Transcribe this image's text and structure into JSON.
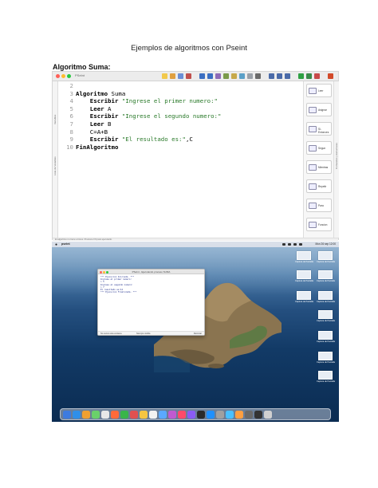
{
  "document": {
    "title": "Ejemplos de algoritmos con Pseint",
    "section": "Algoritmo Suma:"
  },
  "pseint": {
    "window_title": "PSeInt",
    "left_labels": [
      "Variables",
      "Lista de Variables",
      "Operadores y Funciones"
    ],
    "code": [
      {
        "n": "2",
        "parts": []
      },
      {
        "n": "3",
        "parts": [
          {
            "t": "Algoritmo",
            "c": "kw"
          },
          {
            "t": " Suma",
            "c": "id"
          }
        ]
      },
      {
        "n": "4",
        "parts": [
          {
            "t": "    Escribir ",
            "c": "kw"
          },
          {
            "t": "\"Ingrese el primer numero:\"",
            "c": "str"
          }
        ]
      },
      {
        "n": "5",
        "parts": [
          {
            "t": "    Leer ",
            "c": "kw"
          },
          {
            "t": "A",
            "c": "id"
          }
        ]
      },
      {
        "n": "6",
        "parts": [
          {
            "t": "    Escribir ",
            "c": "kw"
          },
          {
            "t": "\"Ingrese el segundo numero:\"",
            "c": "str"
          }
        ]
      },
      {
        "n": "7",
        "parts": [
          {
            "t": "    Leer ",
            "c": "kw"
          },
          {
            "t": "B",
            "c": "id"
          }
        ]
      },
      {
        "n": "8",
        "parts": [
          {
            "t": "    C=A+B",
            "c": "id"
          }
        ]
      },
      {
        "n": "9",
        "parts": [
          {
            "t": "    Escribir ",
            "c": "kw"
          },
          {
            "t": "\"El resultado es:\"",
            "c": "str"
          },
          {
            "t": ",C",
            "c": "id"
          }
        ]
      },
      {
        "n": "10",
        "parts": [
          {
            "t": "FinAlgoritmo",
            "c": "kw"
          }
        ]
      }
    ],
    "commands": [
      "Leer",
      "Asignar",
      "Si-Entonces",
      "Segun",
      "Mientras",
      "Repetir",
      "Para",
      "Funcion"
    ],
    "right_label": "Comandos y Estructuras",
    "status": "El algoritmo no tiene errores. Presione F9 para ejecutarlo."
  },
  "desktop": {
    "menu_app": "pseint",
    "clock": "Mon 26 sep 12:00",
    "terminal": {
      "title": "PSeInt - Ejecutando proceso SUMA",
      "lines": [
        "*** Ejecucion Iniciada. ***",
        "Ingrese el primer numero:",
        "> 5",
        "Ingrese el segundo numero:",
        "> 7",
        "El resultado es:12",
        "*** Ejecucion Finalizada. ***"
      ],
      "footer_left": "No cerrar esta ventana",
      "footer_mid": "Siempre visible",
      "footer_right": "Reiniciar"
    },
    "files": [
      "Captura de Pantalla",
      "Captura de Pantalla",
      "Captura de Pantalla",
      "Captura de Pantalla",
      "Captura de Pantalla",
      "Captura de Pantalla",
      "Captura de Pantalla",
      "Captura de Pantalla",
      "Captura de Pantalla",
      "Captura de Pantalla"
    ]
  },
  "colors": {
    "traffic_red": "#ff5f57",
    "traffic_yellow": "#febc2e",
    "traffic_green": "#28c840",
    "string_green": "#2a7a2a",
    "terminal_text": "#1b2a8a"
  }
}
